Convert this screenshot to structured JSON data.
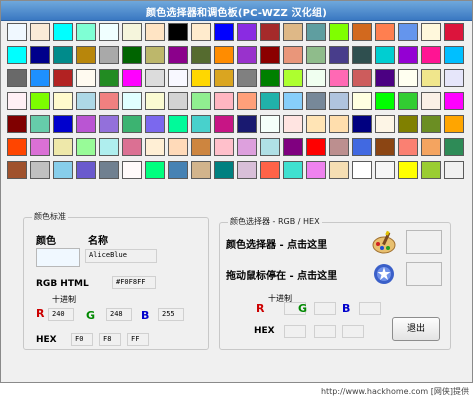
{
  "window": {
    "title": "颜色选择器和调色板(PC-WZZ 汉化组)"
  },
  "palette": {
    "rows": [
      [
        "#f0f8ff",
        "#faebd7",
        "#00ffff",
        "#7fffd4",
        "#f0ffff",
        "#f5f5dc",
        "#ffe4c4",
        "#000000",
        "#ffebcd",
        "#0000ff",
        "#8a2be2",
        "#a52a2a",
        "#deb887",
        "#5f9ea0",
        "#7fff00",
        "#d2691e",
        "#ff7f50",
        "#6495ed",
        "#fff8dc",
        "#dc143c"
      ],
      [
        "#00ffff",
        "#00008b",
        "#008b8b",
        "#b8860b",
        "#a9a9a9",
        "#006400",
        "#bdb76b",
        "#8b008b",
        "#556b2f",
        "#ff8c00",
        "#9932cc",
        "#8b0000",
        "#e9967a",
        "#8fbc8b",
        "#483d8b",
        "#2f4f4f",
        "#00ced1",
        "#9400d3",
        "#ff1493",
        "#00bfff"
      ],
      [
        "#696969",
        "#1e90ff",
        "#b22222",
        "#fffaf0",
        "#228b22",
        "#ff00ff",
        "#dcdcdc",
        "#f8f8ff",
        "#ffd700",
        "#daa520",
        "#808080",
        "#008000",
        "#adff2f",
        "#f0fff0",
        "#ff69b4",
        "#cd5c5c",
        "#4b0082",
        "#fffff0",
        "#f0e68c",
        "#e6e6fa"
      ],
      [
        "#fff0f5",
        "#7cfc00",
        "#fffacd",
        "#add8e6",
        "#f08080",
        "#e0ffff",
        "#fafad2",
        "#d3d3d3",
        "#90ee90",
        "#ffb6c1",
        "#ffa07a",
        "#20b2aa",
        "#87cefa",
        "#778899",
        "#b0c4de",
        "#ffffe0",
        "#00ff00",
        "#32cd32",
        "#faf0e6",
        "#ff00ff"
      ],
      [
        "#800000",
        "#66cdaa",
        "#0000cd",
        "#ba55d3",
        "#9370db",
        "#3cb371",
        "#7b68ee",
        "#00fa9a",
        "#48d1cc",
        "#c71585",
        "#191970",
        "#f5fffa",
        "#ffe4e1",
        "#ffe4b5",
        "#ffdead",
        "#000080",
        "#fdf5e6",
        "#808000",
        "#6b8e23",
        "#ffa500"
      ],
      [
        "#ff4500",
        "#da70d6",
        "#eee8aa",
        "#98fb98",
        "#afeeee",
        "#db7093",
        "#ffefd5",
        "#ffdab9",
        "#cd853f",
        "#ffc0cb",
        "#dda0dd",
        "#b0e0e6",
        "#800080",
        "#ff0000",
        "#bc8f8f",
        "#4169e1",
        "#8b4513",
        "#fa8072",
        "#f4a460",
        "#2e8b57"
      ],
      [
        "#a0522d",
        "#c0c0c0",
        "#87ceeb",
        "#6a5acd",
        "#708090",
        "#fffafa",
        "#00ff7f",
        "#4682b4",
        "#d2b48c",
        "#008080",
        "#d8bfd8",
        "#ff6347",
        "#40e0d0",
        "#ee82ee",
        "#f5deb3",
        "#ffffff",
        "#f5f5f5",
        "#ffff00",
        "#9acd32",
        "#f0f0f0"
      ]
    ]
  },
  "standard": {
    "group_title": "颜色标准",
    "color_label": "颜色",
    "name_label": "名称",
    "name_value": "AliceBlue",
    "swatch_color": "#f0f8ff",
    "rgb_html_label": "RGB HTML",
    "html_value": "#F0F8FF",
    "decimal_label": "十进制",
    "r_label": "R",
    "g_label": "G",
    "b_label": "B",
    "r_value": "240",
    "g_value": "248",
    "b_value": "255",
    "hex_label": "HEX",
    "hex_r": "F0",
    "hex_g": "F8",
    "hex_b": "FF"
  },
  "picker": {
    "group_title": "颜色选择器 - RGB / HEX",
    "click_label": "颜色选择器 - 点击这里",
    "drag_label": "拖动鼠标停在 - 点击这里",
    "decimal_label": "十进制",
    "r_label": "R",
    "g_label": "G",
    "b_label": "B",
    "hex_label": "HEX",
    "exit_label": "退出",
    "paint_icon": "paint-brush-palette-icon",
    "drag_icon": "target-cursor-icon"
  },
  "status": {
    "text": "http://www.hackhome.com [网侠]提供"
  },
  "colors": {
    "r": "#cc0000",
    "g": "#008800",
    "b": "#0000cc",
    "title_bg": "#4a87c9"
  }
}
